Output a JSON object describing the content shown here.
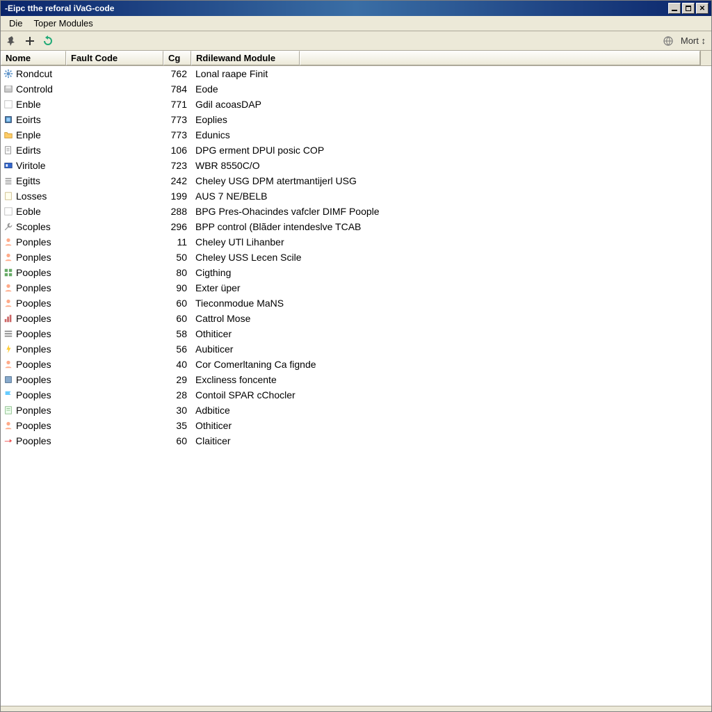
{
  "titlebar": {
    "title": "-Eipc tthe reforal iVaG-code"
  },
  "menubar": {
    "items": [
      "Die",
      "Toper Modules"
    ]
  },
  "toolbar": {
    "right_label": "Mort ↕"
  },
  "columns": {
    "name": "Nome",
    "fault": "Fault Code",
    "cg": "Cg",
    "module": "Rdilewand Module"
  },
  "rows": [
    {
      "icon": "gear",
      "name": "Rondcut",
      "fault": "",
      "cg": "762",
      "module": "Lonal raape Finit"
    },
    {
      "icon": "disk",
      "name": "Controld",
      "fault": "",
      "cg": "784",
      "module": "Eode"
    },
    {
      "icon": "blank",
      "name": "Enble",
      "fault": "",
      "cg": "771",
      "module": "Gdil acoasDAP"
    },
    {
      "icon": "chip",
      "name": "Eoirts",
      "fault": "",
      "cg": "773",
      "module": "Eoplies"
    },
    {
      "icon": "folder",
      "name": "Enple",
      "fault": "",
      "cg": "773",
      "module": "Edunics"
    },
    {
      "icon": "doc",
      "name": "Edirts",
      "fault": "",
      "cg": "106",
      "module": "DPG erment DPUl posic COP"
    },
    {
      "icon": "module",
      "name": "Viritole",
      "fault": "",
      "cg": "723",
      "module": "WBR 8550C/O"
    },
    {
      "icon": "list",
      "name": "Egitts",
      "fault": "",
      "cg": "242",
      "module": "Cheley USG DPM atertmantijerl USG"
    },
    {
      "icon": "page",
      "name": "Losses",
      "fault": "",
      "cg": "199",
      "module": "AUS 7 NE/BELB"
    },
    {
      "icon": "blank",
      "name": "Eoble",
      "fault": "",
      "cg": "288",
      "module": "BPG Pres-Ohacindes vafcler DIMF Poople"
    },
    {
      "icon": "wrench",
      "name": "Scoples",
      "fault": "",
      "cg": "296",
      "module": "BPP control (Blãder intendeslve TCAB"
    },
    {
      "icon": "person",
      "name": "Ponples",
      "fault": "",
      "cg": "11",
      "module": "Cheley UTl Lihanber"
    },
    {
      "icon": "person",
      "name": "Ponples",
      "fault": "",
      "cg": "50",
      "module": "Cheley USS Lecen Scile"
    },
    {
      "icon": "grid",
      "name": "Pooples",
      "fault": "",
      "cg": "80",
      "module": "Cigthing"
    },
    {
      "icon": "person",
      "name": "Ponples",
      "fault": "",
      "cg": "90",
      "module": "Exter üper"
    },
    {
      "icon": "person",
      "name": "Pooples",
      "fault": "",
      "cg": "60",
      "module": "Tieconmodue MaNS"
    },
    {
      "icon": "bars",
      "name": "Pooples",
      "fault": "",
      "cg": "60",
      "module": "Cattrol Mose"
    },
    {
      "icon": "lines",
      "name": "Pooples",
      "fault": "",
      "cg": "58",
      "module": "Othiticer"
    },
    {
      "icon": "spark",
      "name": "Ponples",
      "fault": "",
      "cg": "56",
      "module": "Aubiticer"
    },
    {
      "icon": "person",
      "name": "Pooples",
      "fault": "",
      "cg": "40",
      "module": "Cor Comerltaning Ca fignde"
    },
    {
      "icon": "box",
      "name": "Pooples",
      "fault": "",
      "cg": "29",
      "module": "Excliness foncente"
    },
    {
      "icon": "flag",
      "name": "Pooples",
      "fault": "",
      "cg": "28",
      "module": "Contoil SPAR cChocler"
    },
    {
      "icon": "note",
      "name": "Ponples",
      "fault": "",
      "cg": "30",
      "module": "Adbitice"
    },
    {
      "icon": "person",
      "name": "Pooples",
      "fault": "",
      "cg": "35",
      "module": "Othiticer"
    },
    {
      "icon": "arrow",
      "name": "Pooples",
      "fault": "",
      "cg": "60",
      "module": "Claiticer"
    }
  ]
}
